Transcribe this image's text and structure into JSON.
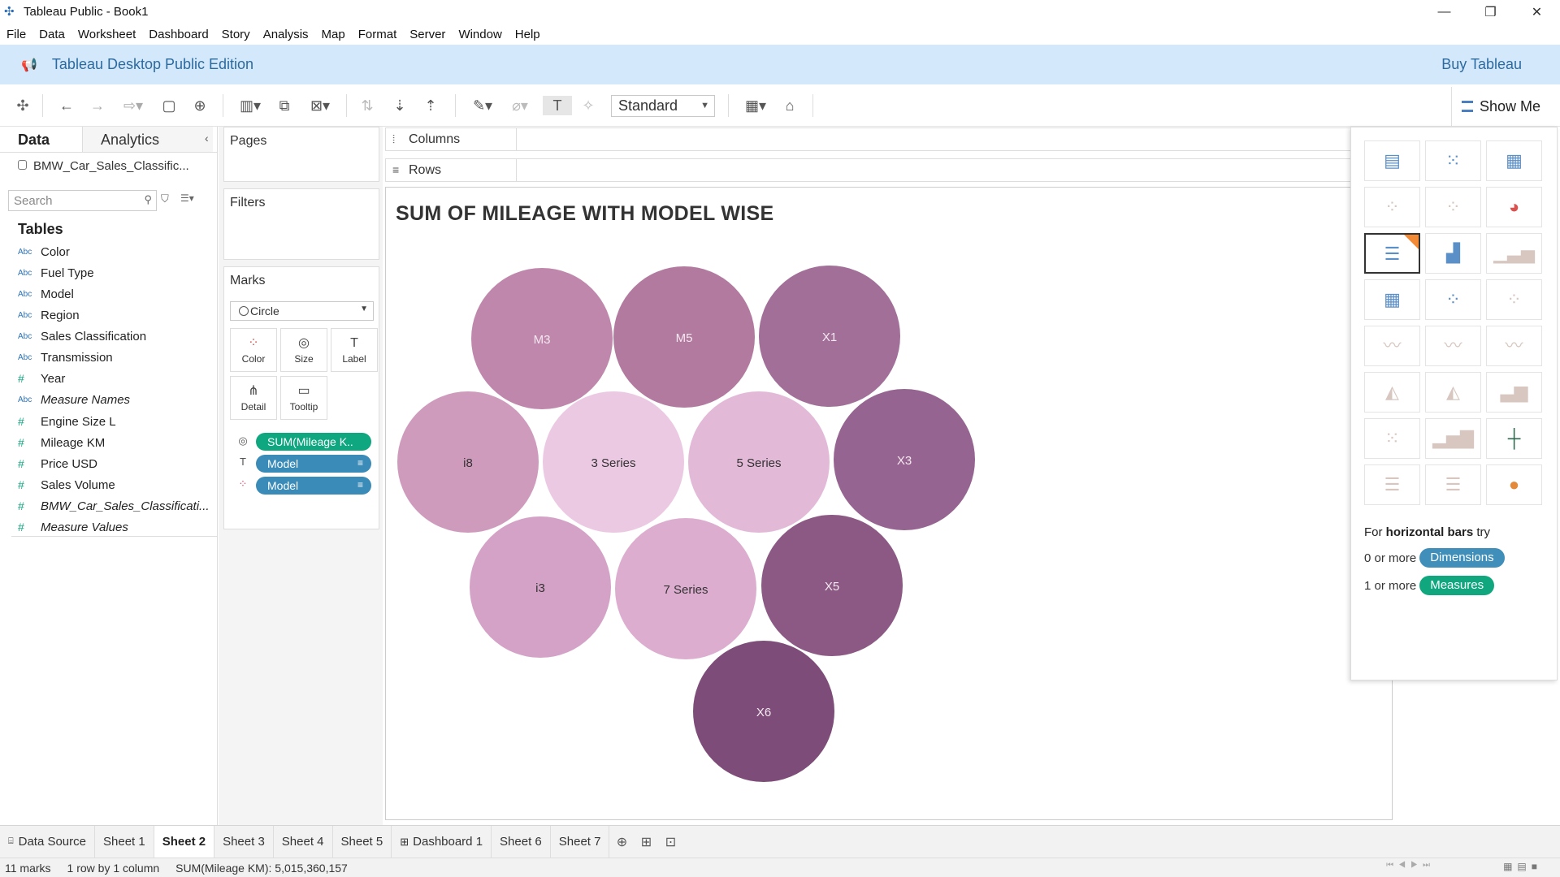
{
  "window": {
    "title": "Tableau Public - Book1",
    "controls": [
      "—",
      "❐",
      "✕"
    ]
  },
  "menu": [
    "File",
    "Data",
    "Worksheet",
    "Dashboard",
    "Story",
    "Analysis",
    "Map",
    "Format",
    "Server",
    "Window",
    "Help"
  ],
  "banner": {
    "edition": "Tableau Desktop Public Edition",
    "buy": "Buy Tableau"
  },
  "toolbar": {
    "fit": "Standard",
    "show_me": "Show Me"
  },
  "datapane": {
    "tab_data": "Data",
    "tab_analytics": "Analytics",
    "datasource": "BMW_Car_Sales_Classific...",
    "search_placeholder": "Search",
    "tables_header": "Tables",
    "dimensions": [
      {
        "type": "Abc",
        "name": "Color"
      },
      {
        "type": "Abc",
        "name": "Fuel Type"
      },
      {
        "type": "Abc",
        "name": "Model"
      },
      {
        "type": "Abc",
        "name": "Region"
      },
      {
        "type": "Abc",
        "name": "Sales Classification"
      },
      {
        "type": "Abc",
        "name": "Transmission"
      },
      {
        "type": "#",
        "name": "Year"
      },
      {
        "type": "Abc",
        "name": "Measure Names"
      }
    ],
    "measures": [
      {
        "type": "#",
        "name": "Engine Size L"
      },
      {
        "type": "#",
        "name": "Mileage KM"
      },
      {
        "type": "#",
        "name": "Price USD"
      },
      {
        "type": "#",
        "name": "Sales Volume"
      },
      {
        "type": "#",
        "name": "BMW_Car_Sales_Classificati..."
      },
      {
        "type": "#",
        "name": "Measure Values"
      }
    ]
  },
  "shelves": {
    "pages": "Pages",
    "filters": "Filters",
    "marks": "Marks",
    "mark_type": "Circle",
    "mark_buttons": [
      "Color",
      "Size",
      "Label",
      "Detail",
      "Tooltip"
    ],
    "pills": [
      "SUM(Mileage K..",
      "Model",
      "Model"
    ],
    "columns": "Columns",
    "rows": "Rows"
  },
  "viz": {
    "title": "SUM OF MILEAGE WITH MODEL WISE"
  },
  "chart_data": {
    "type": "packed-bubble",
    "title": "SUM OF MILEAGE WITH MODEL WISE",
    "measure": "SUM(Mileage KM)",
    "total": 5015360157,
    "bubbles": [
      {
        "label": "M3",
        "color": "#bf87ab"
      },
      {
        "label": "M5",
        "color": "#b27a9f"
      },
      {
        "label": "X1",
        "color": "#a26f99"
      },
      {
        "label": "i8",
        "color": "#cf9bbd"
      },
      {
        "label": "3 Series",
        "color": "#ecc9e2"
      },
      {
        "label": "5 Series",
        "color": "#e3b9d8"
      },
      {
        "label": "X3",
        "color": "#966490"
      },
      {
        "label": "i3",
        "color": "#d4a2c6"
      },
      {
        "label": "7 Series",
        "color": "#dcadcf"
      },
      {
        "label": "X5",
        "color": "#8b5984"
      },
      {
        "label": "X6",
        "color": "#7d4c78"
      }
    ]
  },
  "showme": {
    "hint_prefix": "For ",
    "hint_bold": "horizontal bars",
    "hint_suffix": " try",
    "req1_text": "0 or more",
    "req1_pill": "Dimensions",
    "req2_text": "1 or more",
    "req2_pill": "Measures"
  },
  "sheet_tabs": [
    "Data Source",
    "Sheet 1",
    "Sheet 2",
    "Sheet 3",
    "Sheet 4",
    "Sheet 5",
    "Dashboard 1",
    "Sheet 6",
    "Sheet 7"
  ],
  "active_sheet": "Sheet 2",
  "status": {
    "marks": "11 marks",
    "dims": "1 row by 1 column",
    "sum": "SUM(Mileage KM): 5,015,360,157"
  }
}
